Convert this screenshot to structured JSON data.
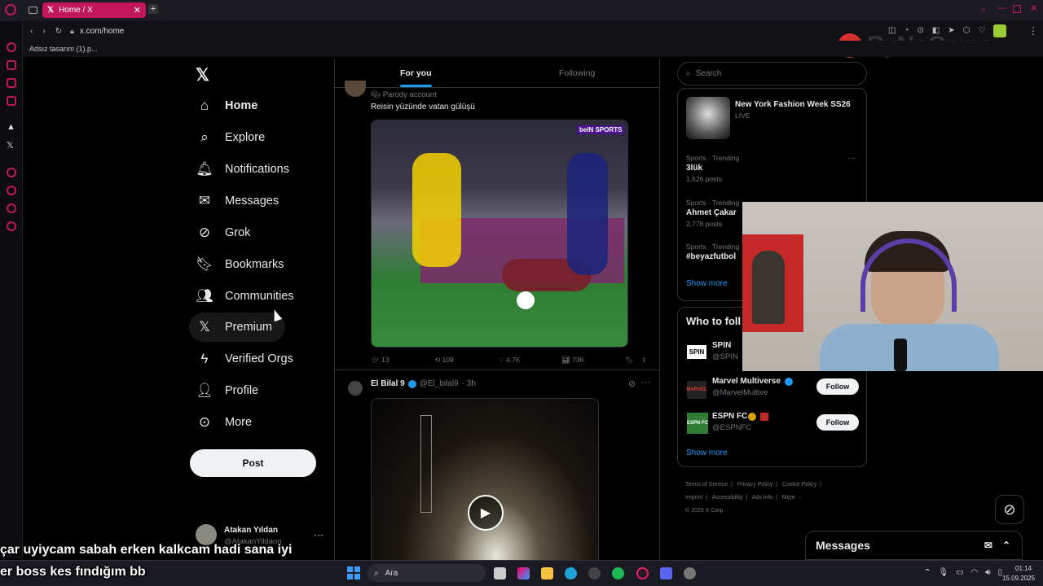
{
  "browser": {
    "tab_title": "Home / X",
    "url": "x.com/home",
    "bookmark": "Adsız tasarım (1).p...",
    "watermark": "ByNoGame"
  },
  "nav": {
    "items": [
      {
        "label": "Home",
        "icon": "home-icon"
      },
      {
        "label": "Explore",
        "icon": "search-icon"
      },
      {
        "label": "Notifications",
        "icon": "bell-icon"
      },
      {
        "label": "Messages",
        "icon": "mail-icon"
      },
      {
        "label": "Grok",
        "icon": "grok-icon"
      },
      {
        "label": "Bookmarks",
        "icon": "bookmark-icon"
      },
      {
        "label": "Communities",
        "icon": "communities-icon"
      },
      {
        "label": "Premium",
        "icon": "x-logo-icon"
      },
      {
        "label": "Verified Orgs",
        "icon": "lightning-icon"
      },
      {
        "label": "Profile",
        "icon": "person-icon"
      },
      {
        "label": "More",
        "icon": "more-circle-icon"
      }
    ],
    "post_label": "Post",
    "account_name": "Atakan Yıldan",
    "account_handle": "@AtakanYildann"
  },
  "timeline": {
    "tab_foryou": "For you",
    "tab_following": "Following",
    "post1": {
      "badge": "Parody account",
      "text": "Reisin yüzünde vatan gülüşü",
      "media_logo": "beIN SPORTS",
      "replies": "13",
      "reposts": "109",
      "likes": "4.7K",
      "views": "73K"
    },
    "post2": {
      "name": "El Bilal 9",
      "handle": "@El_bilal9",
      "time": "· 3h"
    }
  },
  "right": {
    "search_placeholder": "Search",
    "trends": [
      {
        "name": "New York Fashion Week SS26",
        "sub": "LIVE"
      },
      {
        "category": "Sports · Trending",
        "name": "3lük",
        "posts": "1,626 posts"
      },
      {
        "category": "Sports · Trending",
        "name": "Ahmet Çakar",
        "posts": "2,778 posts"
      },
      {
        "category": "Sports · Trending",
        "name": "#beyazfutbol"
      }
    ],
    "show_more": "Show more",
    "who_title": "Who to foll",
    "who": [
      {
        "name": "SPIN",
        "handle": "@SPIN",
        "logo": "SPIN"
      },
      {
        "name": "Marvel Multiverse",
        "handle": "@MarvelMultive",
        "follow": "Follow",
        "logo": "MARVEL"
      },
      {
        "name": "ESPN FC",
        "handle": "@ESPNFC",
        "follow": "Follow",
        "logo": "ESPN FC"
      }
    ],
    "footer": [
      "Terms of Service",
      "|",
      "Privacy Policy",
      "|",
      "Cookie Policy",
      "|",
      "Imprint",
      "|",
      "Accessibility",
      "|",
      "Ads info",
      "|",
      "More ···",
      "© 2025 X Corp."
    ],
    "messages_title": "Messages"
  },
  "subtitles": {
    "line1": "çar uyiycam sabah erken kalkcam hadi sana iyi",
    "line2": "er boss kes fındığım bb"
  },
  "taskbar": {
    "search": "Ara",
    "time": "01:14",
    "date": "15.09.2025"
  },
  "colors": {
    "accent": "#1d9bf0",
    "opera": "#c2185b",
    "border": "#2f3336"
  }
}
